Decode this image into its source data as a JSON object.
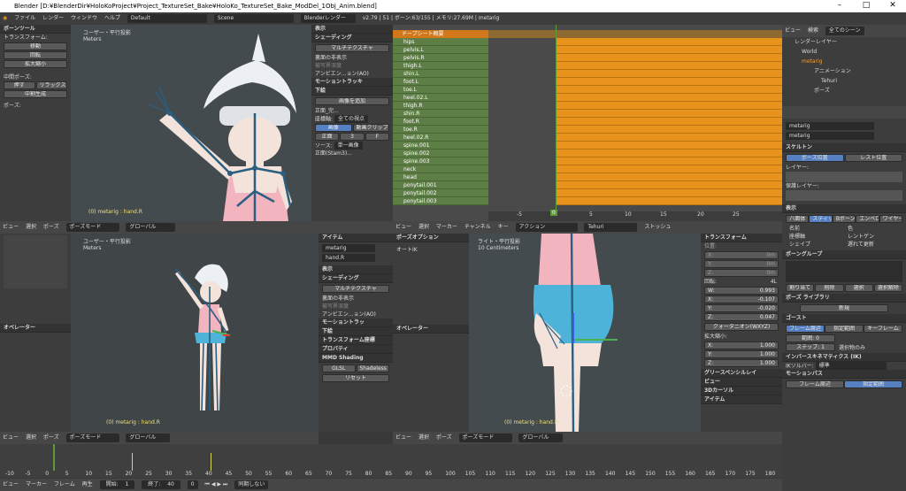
{
  "window": {
    "title": "Blender [D:¥BlenderDir¥HoloKoProject¥Project_TextureSet_Bake¥HoloKo_TextureSet_Bake_ModDel_1Obj_Anim.blend]"
  },
  "menubar": {
    "items": [
      "ファイル",
      "レンダー",
      "ウィンドウ",
      "ヘルプ"
    ],
    "screen": "Default",
    "scene": "Scene",
    "engine": "Blenderレンダー",
    "version": "v2.79 | 51 | ボーン:63/155 | メモリ:27.69M | metarig"
  },
  "tools_upper": {
    "title": "ボーンツール",
    "transform_header": "トランスフォーム:",
    "buttons": [
      "移動",
      "回転",
      "拡大縮小"
    ],
    "pose_header": "中間ポーズ:",
    "pose_buttons": [
      "押す",
      "リラックス"
    ],
    "breakdown": "中割生成",
    "pose2": "ポーズ:"
  },
  "viewport_top": {
    "title": "ユーザー・平行投影",
    "units": "Meters",
    "status": "(0) metarig : hand.R"
  },
  "props_top": {
    "labels": [
      "表示",
      "シェーディング"
    ],
    "shading": "マルチテクスチャ",
    "checks": [
      "裏面の非表示",
      "被写界深度",
      "アンビエン...ョン(AO)"
    ],
    "motion": "モーショントラッキ",
    "bg": "下絵",
    "add_image": "画像を追加",
    "bg_item": "正面_完...",
    "axis_label": "座標軸:",
    "axis_value": "全ての視点",
    "image_btn": "画像",
    "clip_btn": "動画クリップ",
    "pos_btns": [
      "正面",
      "3",
      "F"
    ],
    "source_label": "ソース:",
    "source_value": "単一画像",
    "file": "正面(Stam3)..."
  },
  "dopesheet": {
    "summary": "ドープシート概要",
    "channels": [
      "hips",
      "pelvis.L",
      "pelvis.R",
      "thigh.L",
      "shin.L",
      "foot.L",
      "toe.L",
      "heel.02.L",
      "thigh.R",
      "shin.R",
      "foot.R",
      "toe.R",
      "heel.02.R",
      "spine.001",
      "spine.002",
      "spine.003",
      "neck",
      "head",
      "ponytail.001",
      "ponytail.002",
      "ponytail.003"
    ],
    "ticks": [
      "-5",
      "0",
      "5",
      "10",
      "15",
      "20",
      "25"
    ],
    "current_frame": "0"
  },
  "outliner": {
    "menus": [
      "ビュー",
      "検索",
      "全てのシーン"
    ],
    "items": [
      "レンダーレイヤー",
      "World",
      "metarig",
      "アニメーション",
      "Tehuri",
      "ポーズ"
    ]
  },
  "props_right": {
    "bone_name": "metarig",
    "armature": "metarig",
    "skeleton": "スケルトン",
    "pose_pos": "ポーズ位置",
    "rest_pos": "レスト位置",
    "layers": "レイヤー:",
    "protected": "保護レイヤー:",
    "display": "表示",
    "disp_types": [
      "八面体",
      "スティック",
      "Bボーン",
      "エンベロープ",
      "ワイヤー"
    ],
    "disp_checks": [
      "名前",
      "色",
      "座標軸",
      "レントゲン",
      "シェイプ",
      "遅れて更新"
    ],
    "bone_group": "ボーングループ",
    "bg_btns": [
      "割り当て",
      "削除",
      "選択",
      "選択解除"
    ],
    "pose_lib": "ポーズ ライブラリ",
    "new": "新規",
    "ghost": "ゴースト",
    "ghost_btns": [
      "フレーム周辺",
      "指定範囲",
      "キーフレーム"
    ],
    "range_label": "範囲:",
    "range_val": "0",
    "step_label": "ステップ:",
    "step_val": "1",
    "sel_only": "選択物のみ",
    "ik": "インバースキネマティクス (IK)",
    "ik_solver": "IKソルバー:",
    "ik_value": "標準",
    "motion_path": "モーションパス",
    "mp_btns": [
      "フレーム周辺",
      "指定範囲"
    ]
  },
  "viewport_left_bottom": {
    "title": "ユーザー・平行投影",
    "units": "Meters",
    "status": "(0) metarig : hand.R"
  },
  "props_mid": {
    "item": "アイテム",
    "name1": "metarig",
    "name2": "hand.R",
    "labels": [
      "表示",
      "シェーディング"
    ],
    "shading": "マルチテクスチャ",
    "checks": [
      "裏面の非表示",
      "被写界深度",
      "アンビエン...ョン(AO)"
    ],
    "motion": "モーショントラッ",
    "bg": "下絵",
    "transform_orient": "トランスフォーム座標",
    "property": "プロパティ",
    "mmd": "MMD Shading",
    "mmd_btns": [
      "GLSL",
      "Shadeless"
    ],
    "reset": "リセット"
  },
  "tools_mid": {
    "pose_opt": "ポーズオプション",
    "auto_ik": "オートIK",
    "operator": "オペレーター"
  },
  "viewport_right_bottom": {
    "title": "ライト・平行投影",
    "units": "10 Centimeters",
    "status": "(0) metarig : hand.R"
  },
  "transform_panel": {
    "title": "トランスフォーム",
    "location": "位置:",
    "loc": [
      "X:",
      "0m",
      "Y:",
      "0m",
      "Z:",
      "0m"
    ],
    "rotation": "回転:",
    "mode": "4L",
    "quat": [
      [
        "W:",
        "0.993"
      ],
      [
        "X:",
        "-0.107"
      ],
      [
        "Y:",
        "-0.020"
      ],
      [
        "Z:",
        "0.047"
      ]
    ],
    "rot_mode": "クォータニオン(WXYZ)",
    "scale": "拡大縮小:",
    "scale_vals": [
      [
        "X:",
        "1.000"
      ],
      [
        "Y:",
        "1.000"
      ],
      [
        "Z:",
        "1.000"
      ]
    ],
    "grease": "グリースペンシルレイ",
    "view": "ビュー",
    "cursor": "3Dカーソル",
    "item": "アイテム"
  },
  "action_header": {
    "menus": [
      "ビュー",
      "選択",
      "マーカー",
      "チャンネル",
      "キー"
    ],
    "mode": "アクション",
    "action": "Tehuri",
    "stash": "ストッシュ"
  },
  "bottom_headers": {
    "view": "ビュー",
    "select": "選択",
    "pose": "ポーズ",
    "mode": "ポーズモード",
    "orient": "グローバル"
  },
  "timeline": {
    "ticks": [
      "-10",
      "-5",
      "0",
      "5",
      "10",
      "15",
      "20",
      "25",
      "30",
      "35",
      "40",
      "45",
      "50",
      "55",
      "60",
      "65",
      "70",
      "75",
      "80",
      "85",
      "90",
      "95",
      "100",
      "105",
      "110",
      "115",
      "120",
      "125",
      "130",
      "135",
      "140",
      "145",
      "150",
      "155",
      "160",
      "165",
      "170",
      "175",
      "180"
    ],
    "menus": [
      "ビュー",
      "マーカー",
      "フレーム",
      "再生"
    ],
    "start_label": "開始:",
    "start": "1",
    "end_label": "終了:",
    "end": "40",
    "frame": "0",
    "sync": "同期しない"
  }
}
